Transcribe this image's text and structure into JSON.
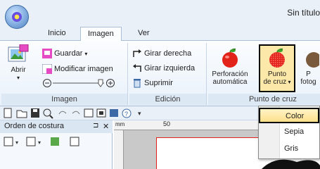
{
  "window": {
    "title": "Sin título"
  },
  "tabs": [
    {
      "label": "Inicio"
    },
    {
      "label": "Imagen"
    },
    {
      "label": "Ver"
    }
  ],
  "ribbon": {
    "imagen_group": {
      "label": "Imagen",
      "abrir": "Abrir",
      "guardar": "Guardar",
      "modificar": "Modificar imagen"
    },
    "edicion_group": {
      "label": "Edición",
      "girar_derecha": "Girar derecha",
      "girar_izquierda": "Girar izquierda",
      "suprimir": "Suprimir"
    },
    "punto_group": {
      "label": "Punto de cruz",
      "perforacion_line1": "Perforación",
      "perforacion_line2": "automática",
      "punto_line1": "Punto",
      "punto_line2": "de cruz",
      "foto_line1": "P",
      "foto_line2": "fotog"
    }
  },
  "panel": {
    "title": "Orden de costura"
  },
  "ruler": {
    "mark": "50",
    "unit": "mm"
  },
  "dropdown": {
    "items": [
      "Color",
      "Sepia",
      "Gris"
    ],
    "selected": "Color"
  },
  "colors": {
    "accent_border": "#000000",
    "selected_fill": "#fde08a",
    "ribbon_bg": "#e9f1fa",
    "apple_red": "#e2231a"
  }
}
